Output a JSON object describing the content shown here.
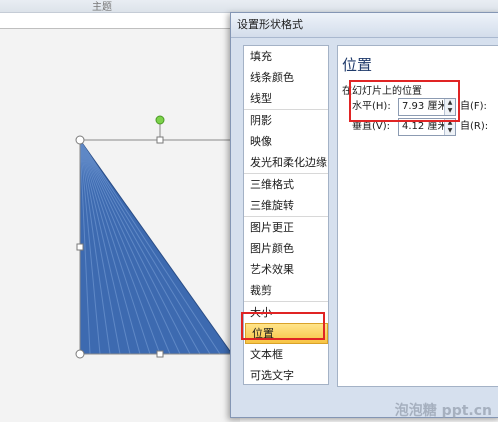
{
  "ribbon": {
    "label": "主题"
  },
  "dialog": {
    "title": "设置形状格式",
    "nav_items": [
      {
        "label": "填充"
      },
      {
        "label": "线条颜色"
      },
      {
        "label": "线型"
      },
      {
        "label": "阴影"
      },
      {
        "label": "映像"
      },
      {
        "label": "发光和柔化边缘"
      },
      {
        "label": "三维格式"
      },
      {
        "label": "三维旋转"
      },
      {
        "label": "图片更正"
      },
      {
        "label": "图片颜色"
      },
      {
        "label": "艺术效果"
      },
      {
        "label": "裁剪"
      },
      {
        "label": "大小"
      },
      {
        "label": "位置",
        "selected": true
      },
      {
        "label": "文本框"
      },
      {
        "label": "可选文字"
      }
    ],
    "section_title": "位置",
    "section_subtitle": "在幻灯片上的位置",
    "horizontal": {
      "label": "水平(H):",
      "value": "7.93 厘米",
      "from": "自(F):"
    },
    "vertical": {
      "label": "垂直(V):",
      "value": "4.12 厘米",
      "from": "自(R):"
    }
  },
  "colors": {
    "shape_fill": "#3d6ab0",
    "highlight": "#e02424",
    "selected_nav": "#f7c443"
  },
  "watermark": "泡泡糖 ppt.cn"
}
